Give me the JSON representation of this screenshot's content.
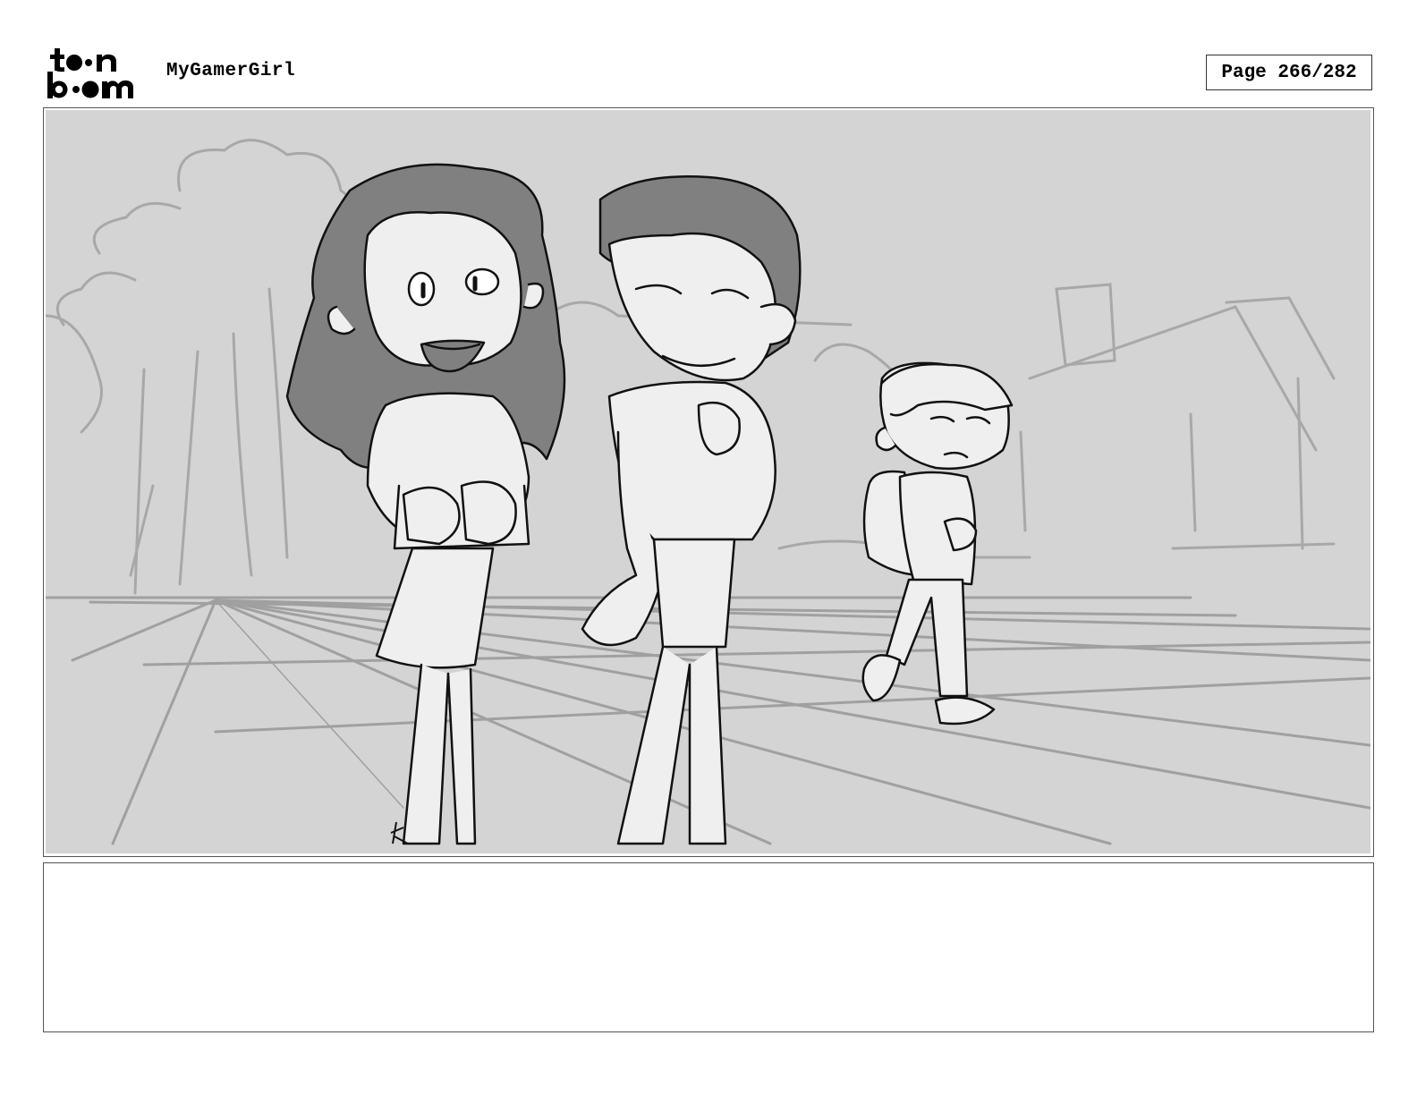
{
  "header": {
    "logo_text": "toon boom",
    "project_title": "MyGamerGirl",
    "page_label": "Page 266/282"
  },
  "panel": {
    "description_text": ""
  },
  "colors": {
    "background": "#d4d4d4",
    "sketch_gray": "#a8a8a8",
    "hair_gray": "#808080",
    "skin_light": "#efefef",
    "ink": "#111111"
  }
}
